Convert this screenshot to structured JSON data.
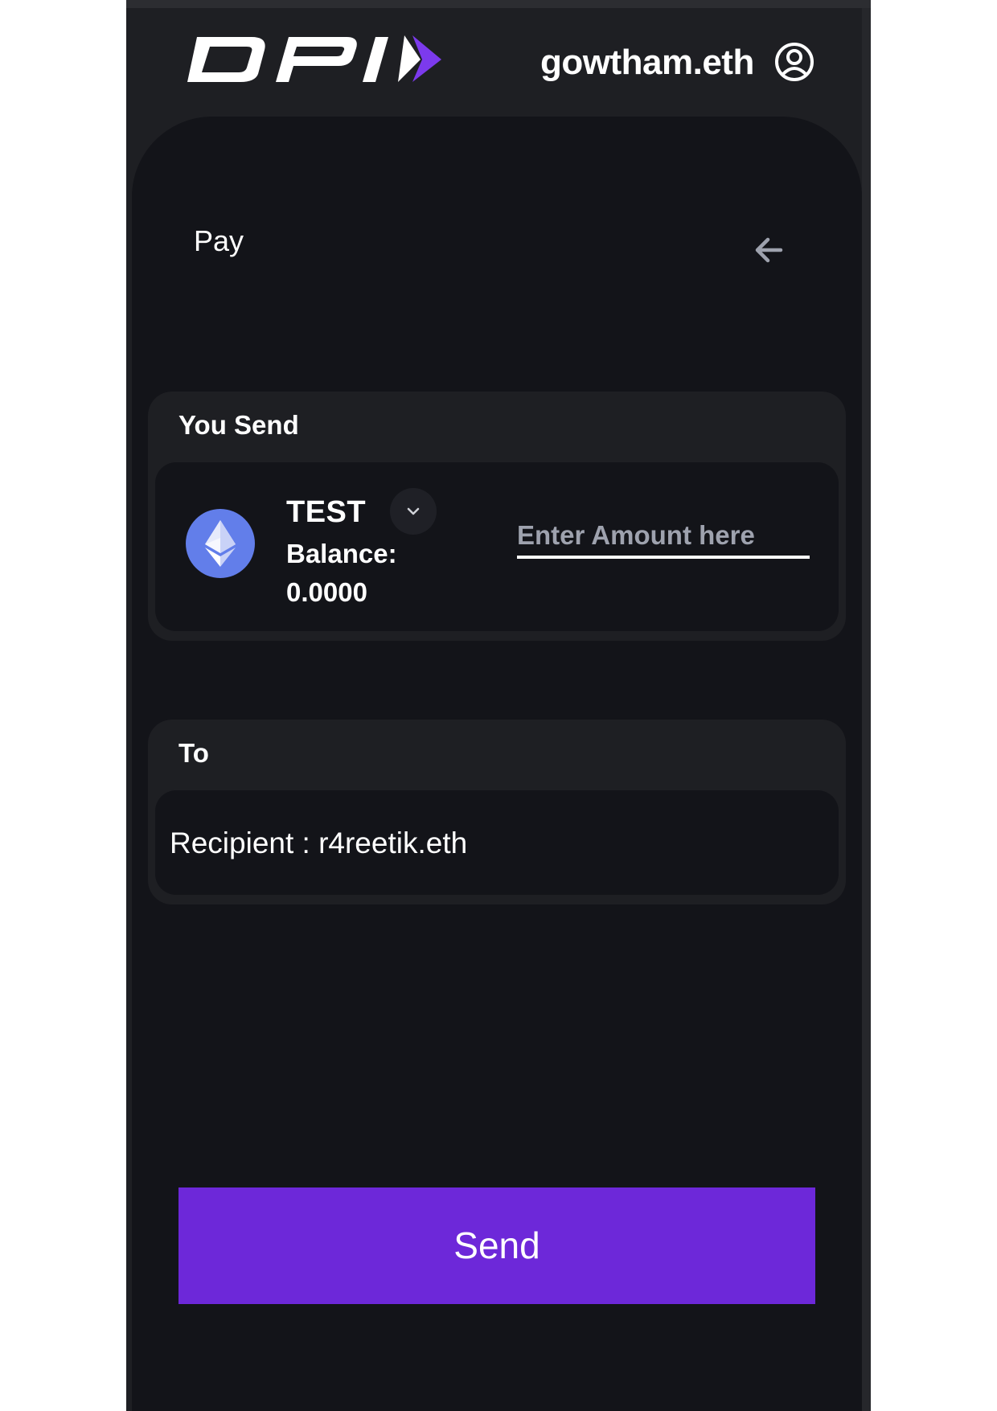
{
  "header": {
    "username": "gowtham.eth",
    "logo_icon": "dpi-logo-icon",
    "profile_icon": "user-circle-icon"
  },
  "page": {
    "title": "Pay",
    "back_icon": "arrow-left-icon"
  },
  "send_section": {
    "label": "You Send",
    "token": {
      "symbol": "TEST",
      "icon": "ethereum-icon",
      "dropdown_icon": "chevron-down-icon",
      "balance_label": "Balance:",
      "balance_value": "0.0000"
    },
    "amount": {
      "value": "",
      "placeholder": "Enter Amount here"
    }
  },
  "to_section": {
    "label": "To",
    "recipient_text": "Recipient : r4reetik.eth"
  },
  "actions": {
    "send_label": "Send"
  },
  "colors": {
    "frame_bg": "#1e1f23",
    "card_bg": "#131419",
    "accent": "#6d28d9",
    "eth_blue": "#627eea"
  }
}
